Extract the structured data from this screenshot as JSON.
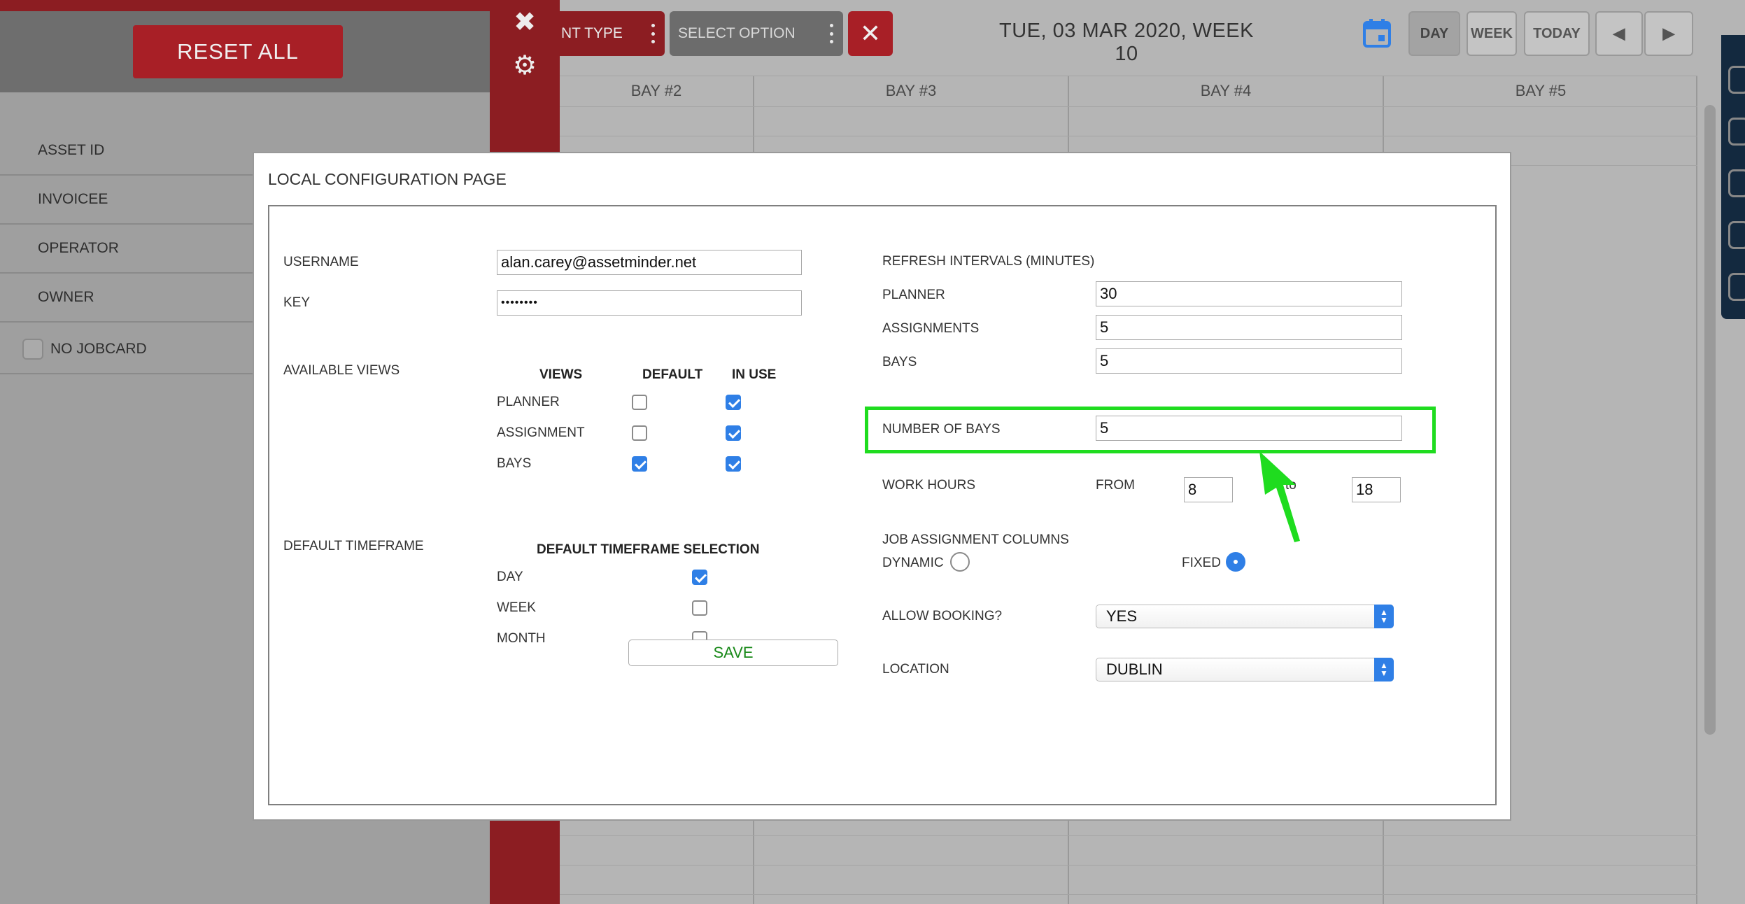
{
  "left_panel": {
    "reset_label": "RESET ALL",
    "filters": [
      "ASSET ID",
      "INVOICEE",
      "OPERATOR",
      "OWNER"
    ],
    "no_jobcard_label": "NO JOBCARD"
  },
  "side_toolbar": {
    "close_glyph": "✖",
    "settings_glyph": "⚙"
  },
  "topbar": {
    "event_type_label": "NT TYPE",
    "select_option_label": "SELECT OPTION",
    "clear_glyph": "✕",
    "date_title": "TUE, 03 MAR 2020, WEEK 10",
    "day_label": "DAY",
    "week_label": "WEEK",
    "today_label": "TODAY",
    "prev_glyph": "◀",
    "next_glyph": "▶"
  },
  "grid": {
    "columns": [
      "BAY #2",
      "BAY #3",
      "BAY #4",
      "BAY #5"
    ]
  },
  "modal": {
    "title": "LOCAL CONFIGURATION PAGE",
    "username_label": "USERNAME",
    "username_value": "alan.carey@assetminder.net",
    "key_label": "KEY",
    "key_value": "••••••••",
    "available_views_label": "AVAILABLE VIEWS",
    "views_header": {
      "views": "VIEWS",
      "default": "DEFAULT",
      "in_use": "IN USE"
    },
    "views": [
      {
        "name": "PLANNER",
        "default": false,
        "in_use": true
      },
      {
        "name": "ASSIGNMENT",
        "default": false,
        "in_use": true
      },
      {
        "name": "BAYS",
        "default": true,
        "in_use": true
      }
    ],
    "default_timeframe_label": "DEFAULT TIMEFRAME",
    "timeframe_header": "DEFAULT TIMEFRAME SELECTION",
    "timeframes": [
      {
        "name": "DAY",
        "checked": true
      },
      {
        "name": "WEEK",
        "checked": false
      },
      {
        "name": "MONTH",
        "checked": false
      }
    ],
    "refresh_label": "REFRESH INTERVALS (MINUTES)",
    "planner_label": "PLANNER",
    "planner_value": "30",
    "assignments_label": "ASSIGNMENTS",
    "assignments_value": "5",
    "bays_label": "BAYS",
    "bays_value": "5",
    "number_of_bays_label": "NUMBER OF BAYS",
    "number_of_bays_value": "5",
    "work_hours_label": "WORK HOURS",
    "from_label": "FROM",
    "from_value": "8",
    "to_label": "to",
    "to_value": "18",
    "job_columns_label": "JOB ASSIGNMENT COLUMNS",
    "dynamic_label": "DYNAMIC",
    "fixed_label": "FIXED",
    "job_columns_selected": "FIXED",
    "allow_booking_label": "ALLOW BOOKING?",
    "allow_booking_value": "YES",
    "location_label": "LOCATION",
    "location_value": "DUBLIN",
    "save_label": "SAVE"
  },
  "colors": {
    "brand_red": "#8c1d22",
    "button_red": "#a81f26",
    "accent_blue": "#2f7fe6",
    "highlight_green": "#1fdc1f",
    "save_green": "#1a8a1a"
  }
}
